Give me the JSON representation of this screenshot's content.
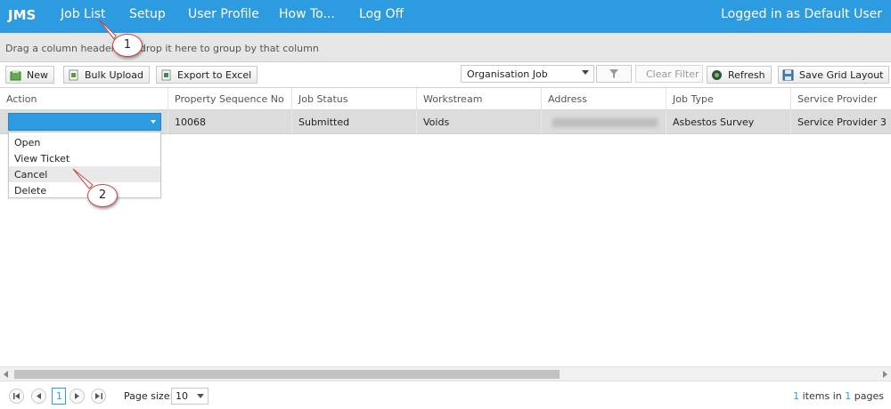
{
  "nav": {
    "brand": "JMS",
    "items": [
      "Job List",
      "Setup",
      "User Profile",
      "How To...",
      "Log Off"
    ],
    "user": "Logged in as Default User"
  },
  "groupbar": {
    "hint": "Drag a column header and drop it here to group by that column"
  },
  "toolbar": {
    "new_label": "New",
    "bulk_label": "Bulk Upload",
    "export_label": "Export to Excel",
    "view_select": "Organisation Job",
    "clear_filter": "Clear Filter",
    "refresh_label": "Refresh",
    "save_layout_label": "Save Grid Layout"
  },
  "grid": {
    "columns": [
      "Action",
      "Property Sequence No",
      "Job Status",
      "Workstream",
      "Address",
      "Job Type",
      "Service Provider"
    ],
    "rows": [
      {
        "action": "",
        "property_seq": "10068",
        "status": "Submitted",
        "workstream": "Voids",
        "address": "",
        "job_type": "Asbestos Survey",
        "provider": "Service Provider 3"
      }
    ]
  },
  "action_menu": {
    "items": [
      "Open",
      "View Ticket",
      "Cancel",
      "Delete"
    ],
    "highlighted": "Cancel"
  },
  "pager": {
    "page": "1",
    "page_size_label": "Page size:",
    "page_size": "10",
    "items_count": "1",
    "items_text": "items in",
    "pages_count": "1",
    "pages_text": "pages"
  },
  "callouts": [
    "1",
    "2"
  ],
  "colors": {
    "accent": "#2d9be0",
    "callout_border": "#cc4444"
  }
}
